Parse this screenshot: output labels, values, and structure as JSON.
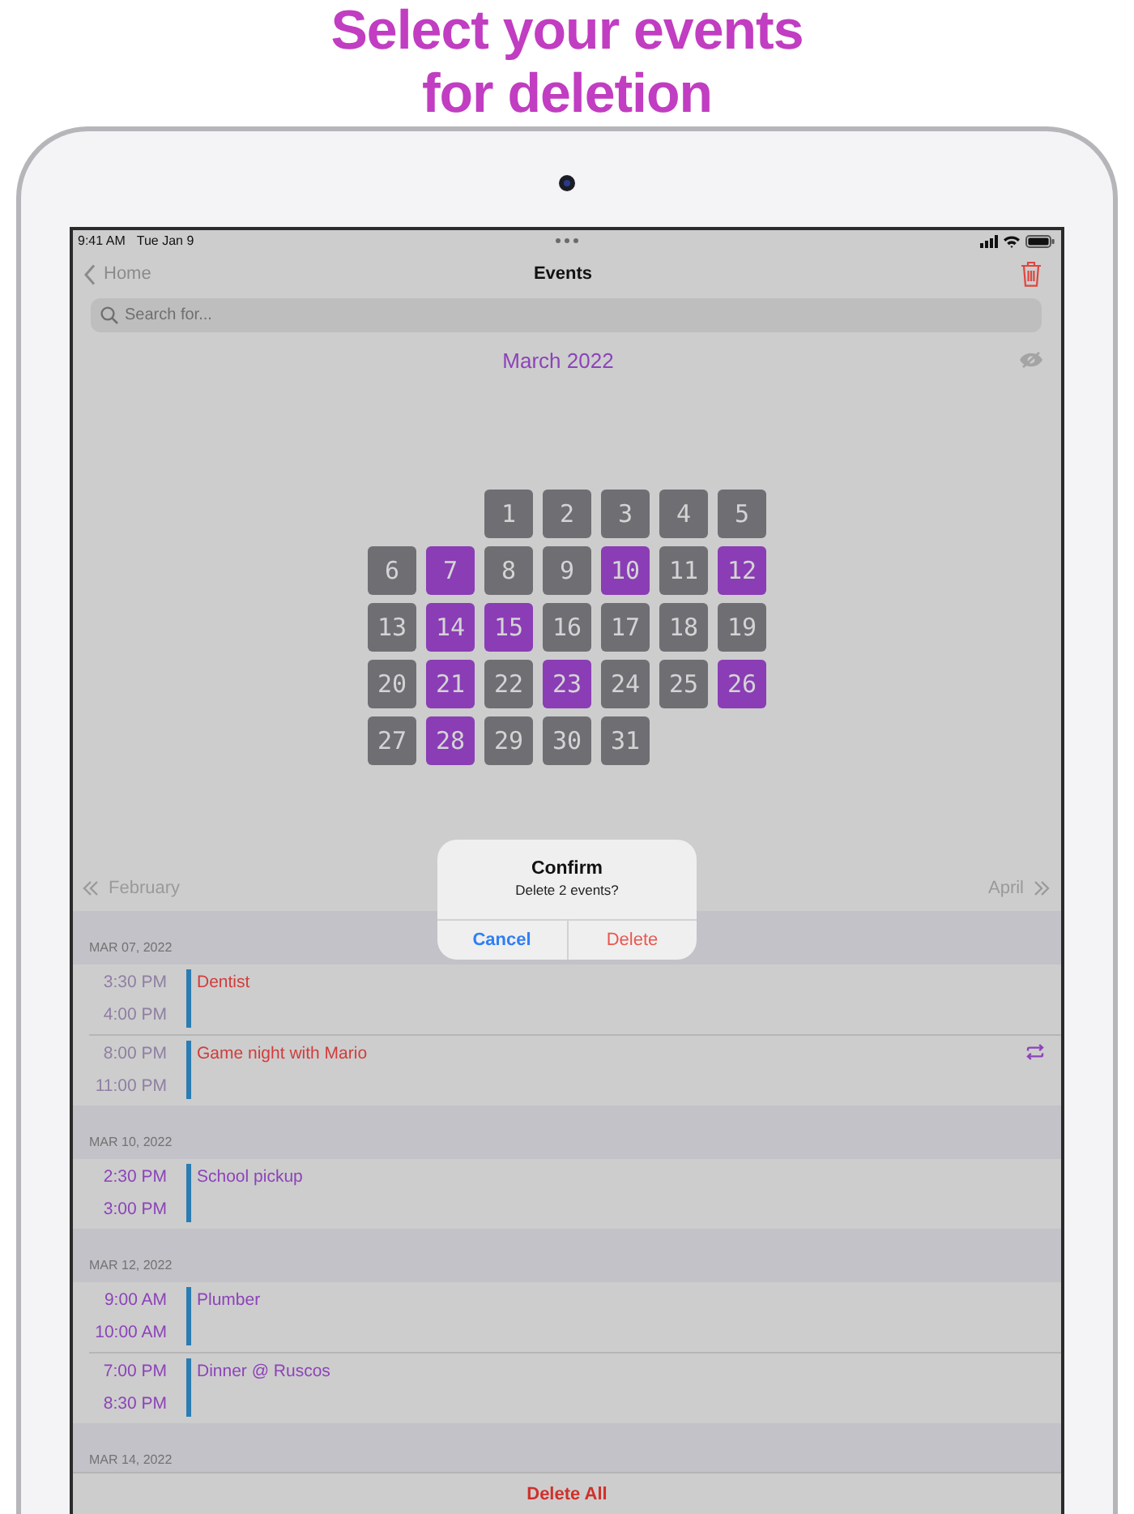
{
  "headline": {
    "lines": [
      "Select your events",
      "for deletion"
    ]
  },
  "status_bar": {
    "time": "9:41 AM",
    "date": "Tue Jan 9"
  },
  "nav_bar": {
    "back_label": "Home",
    "title": "Events"
  },
  "search": {
    "placeholder": "Search for..."
  },
  "calendar": {
    "month": "March 2022",
    "weeks": [
      {
        "days": [
          {
            "label": "1",
            "has_events": false
          },
          {
            "label": "2",
            "has_events": false
          },
          {
            "label": "3",
            "has_events": false
          },
          {
            "label": "4",
            "has_events": false
          },
          {
            "label": "5",
            "has_events": false
          }
        ]
      },
      {
        "days": [
          {
            "label": "6",
            "has_events": false
          },
          {
            "label": "7",
            "has_events": true
          },
          {
            "label": "8",
            "has_events": false
          },
          {
            "label": "9",
            "has_events": false
          },
          {
            "label": "10",
            "has_events": true
          },
          {
            "label": "11",
            "has_events": false
          },
          {
            "label": "12",
            "has_events": true
          }
        ]
      },
      {
        "days": [
          {
            "label": "13",
            "has_events": false
          },
          {
            "label": "14",
            "has_events": true
          },
          {
            "label": "15",
            "has_events": true
          },
          {
            "label": "16",
            "has_events": false
          },
          {
            "label": "17",
            "has_events": false
          },
          {
            "label": "18",
            "has_events": false
          },
          {
            "label": "19",
            "has_events": false
          }
        ]
      },
      {
        "days": [
          {
            "label": "20",
            "has_events": false
          },
          {
            "label": "21",
            "has_events": true
          },
          {
            "label": "22",
            "has_events": false
          },
          {
            "label": "23",
            "has_events": true
          },
          {
            "label": "24",
            "has_events": false
          },
          {
            "label": "25",
            "has_events": false
          },
          {
            "label": "26",
            "has_events": true
          }
        ]
      },
      {
        "days": [
          {
            "label": "27",
            "has_events": false
          },
          {
            "label": "28",
            "has_events": true
          },
          {
            "label": "29",
            "has_events": false
          },
          {
            "label": "30",
            "has_events": false
          },
          {
            "label": "31",
            "has_events": false
          }
        ]
      }
    ],
    "prev_month": "February",
    "next_month": "April"
  },
  "event_list": {
    "sections": [
      {
        "date": "MAR 07, 2022",
        "events": [
          {
            "start": "3:30 PM",
            "end": "4:00 PM",
            "title": "Dentist",
            "selected": true,
            "repeating": false
          },
          {
            "start": "8:00 PM",
            "end": "11:00 PM",
            "title": "Game night with Mario",
            "selected": true,
            "repeating": true
          }
        ]
      },
      {
        "date": "MAR 10, 2022",
        "events": [
          {
            "start": "2:30 PM",
            "end": "3:00 PM",
            "title": "School pickup",
            "selected": false,
            "repeating": false
          }
        ]
      },
      {
        "date": "MAR 12, 2022",
        "events": [
          {
            "start": "9:00 AM",
            "end": "10:00 AM",
            "title": "Plumber",
            "selected": false,
            "repeating": false
          },
          {
            "start": "7:00 PM",
            "end": "8:30 PM",
            "title": "Dinner @ Ruscos",
            "selected": false,
            "repeating": false
          }
        ]
      },
      {
        "date": "MAR 14, 2022"
      }
    ]
  },
  "alert": {
    "title": "Confirm",
    "message": "Delete 2 events?",
    "buttons": [
      {
        "label": "Cancel",
        "kind": "cancel"
      },
      {
        "label": "Delete",
        "kind": "destructive"
      }
    ]
  },
  "toolbar": {
    "action": "Delete All"
  }
}
